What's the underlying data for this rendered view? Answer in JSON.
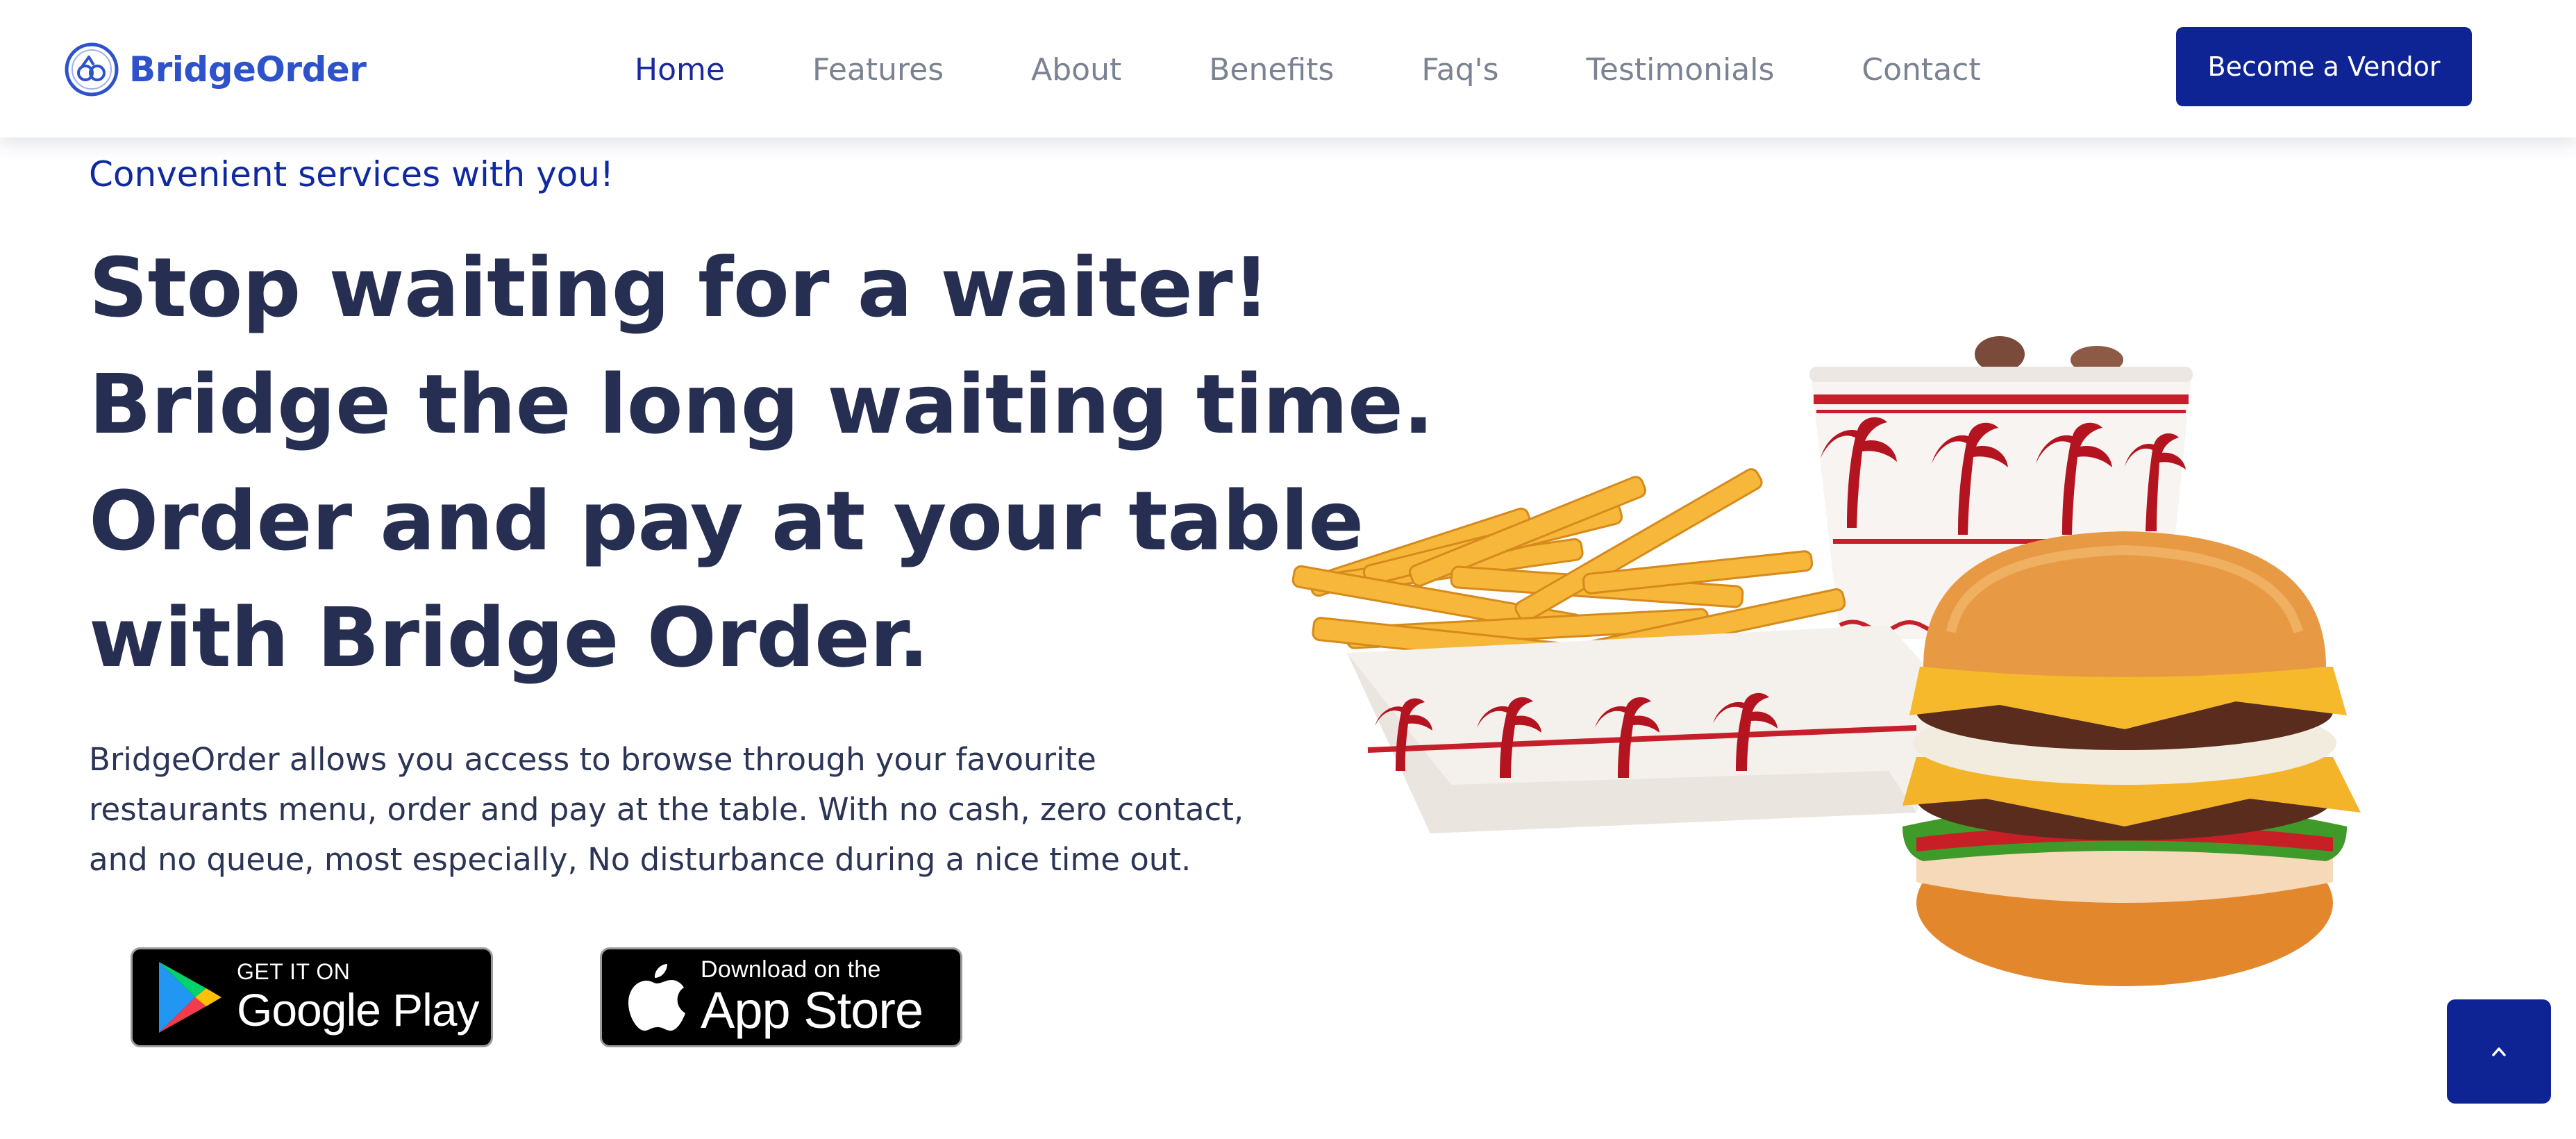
{
  "brand": {
    "name": "BridgeOrder",
    "logo_icon": "bridgeorder-logo-icon",
    "color": "#2d52c9"
  },
  "nav": {
    "items": [
      {
        "label": "Home",
        "active": true
      },
      {
        "label": "Features",
        "active": false
      },
      {
        "label": "About",
        "active": false
      },
      {
        "label": "Benefits",
        "active": false
      },
      {
        "label": "Faq's",
        "active": false
      },
      {
        "label": "Testimonials",
        "active": false
      },
      {
        "label": "Contact",
        "active": false
      }
    ],
    "active_color": "#1a2a9e",
    "inactive_color": "#7b8291"
  },
  "header": {
    "cta_label": "Become a Vendor",
    "cta_color": "#0e2494"
  },
  "hero": {
    "tagline": "Convenient services with you!",
    "headline_lines": [
      "Stop waiting for a waiter!",
      "Bridge the long waiting time.",
      "Order and pay at your table",
      "with Bridge Order."
    ],
    "description": "BridgeOrder allows you access to browse through your favourite restaurants menu, order and pay at the table. With no cash, zero contact, and no queue, most especially, No disturbance during a nice time out.",
    "image_icon": "burger-fries-drink-illustration"
  },
  "store_badges": {
    "google": {
      "small": "GET IT ON",
      "big": "Google Play",
      "icon": "google-play-icon"
    },
    "apple": {
      "small": "Download on the",
      "big": "App Store",
      "icon": "apple-icon"
    }
  },
  "scroll_top": {
    "icon": "chevron-up-icon",
    "color": "#0e2494"
  }
}
